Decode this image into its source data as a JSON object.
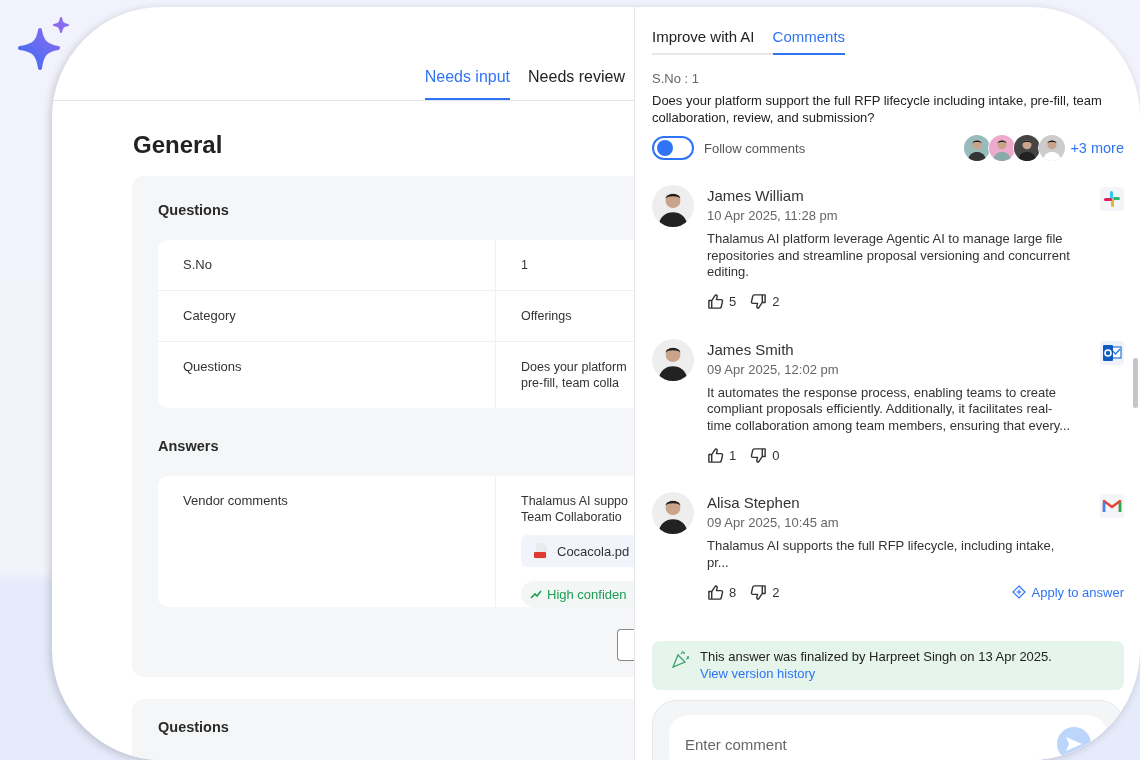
{
  "main": {
    "tabs": [
      {
        "label": "Needs input",
        "selected": true
      },
      {
        "label": "Needs review",
        "selected": false
      }
    ],
    "title": "General",
    "sections": [
      {
        "heading": "Questions",
        "rows": [
          {
            "label": "S.No",
            "lines": [
              "1"
            ]
          },
          {
            "label": "Category",
            "lines": [
              "Offerings"
            ]
          },
          {
            "label": "Questions",
            "lines": [
              "Does your platform",
              "pre-fill, team colla"
            ]
          }
        ]
      },
      {
        "heading": "Answers",
        "rows": [
          {
            "label": "Vendor comments",
            "lines": [
              "Thalamus AI suppo",
              "Team Collaboratio"
            ],
            "attachment": "Cocacola.pd",
            "confidence": "High confiden"
          }
        ]
      }
    ],
    "next_heading": "Questions"
  },
  "panel": {
    "tabs": [
      {
        "label": "Improve with AI",
        "selected": false
      },
      {
        "label": "Comments",
        "selected": true
      }
    ],
    "sno": "S.No : 1",
    "question": "Does your platform support the full RFP lifecycle including intake, pre-fill, team collaboration, review, and submission?",
    "follow": {
      "label": "Follow comments",
      "on": false
    },
    "more": "+3 more",
    "comments": [
      {
        "name": "James William",
        "time": "10 Apr 2025, 11:28 pm",
        "text": "Thalamus AI platform leverage Agentic AI to manage large file repositories and streamline proposal versioning and concurrent editing.",
        "likes": "5",
        "dislikes": "2",
        "kind": "slack"
      },
      {
        "name": "James Smith",
        "time": "09 Apr 2025, 12:02 pm",
        "text": "It automates the response process, enabling teams to create compliant proposals efficiently. Additionally, it facilitates real-time collaboration among team members, ensuring that every...",
        "likes": "1",
        "dislikes": "0",
        "kind": "outlook"
      },
      {
        "name": "Alisa Stephen",
        "time": "09 Apr 2025, 10:45 am",
        "text": "Thalamus AI supports the full RFP lifecycle, including intake, pr...",
        "likes": "8",
        "dislikes": "2",
        "kind": "gmail",
        "action": "Apply to answer"
      }
    ],
    "banner": {
      "text": "This answer was finalized by Harpreet Singh on 13 Apr 2025.",
      "link": "View version history"
    },
    "input": {
      "placeholder": "Enter comment"
    }
  }
}
